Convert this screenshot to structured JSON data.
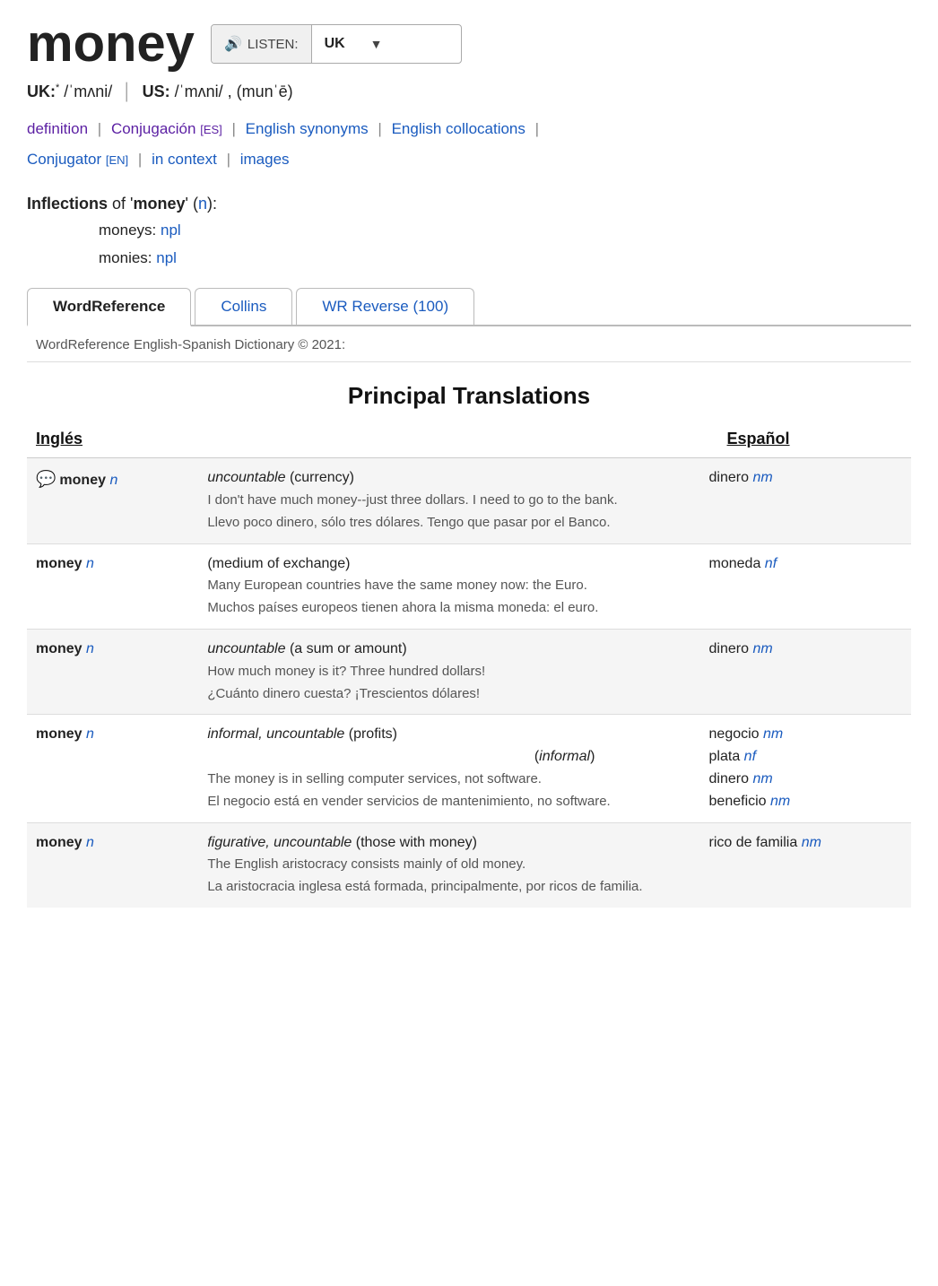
{
  "word": "money",
  "listen": {
    "button_label": "LISTEN:",
    "locale": "UK",
    "dropdown_arrow": "▼"
  },
  "phonetics": {
    "uk_label": "UK:",
    "uk_asterisk": "*",
    "uk_ipa": "/ˈmʌni/",
    "us_label": "US:",
    "us_ipa": "/ˈmʌni/",
    "us_alt": "(munˈē)"
  },
  "nav_links": [
    {
      "text": "definition",
      "color": "purple"
    },
    {
      "text": "Conjugación",
      "tag": "[ES]",
      "color": "purple"
    },
    {
      "text": "English synonyms",
      "color": "blue"
    },
    {
      "text": "English collocations",
      "color": "blue"
    },
    {
      "text": "Conjugator",
      "tag": "[EN]",
      "color": "blue"
    },
    {
      "text": "in context",
      "color": "blue"
    },
    {
      "text": "images",
      "color": "blue"
    }
  ],
  "inflections": {
    "title": "Inflections",
    "word": "money",
    "pos": "n",
    "items": [
      {
        "label": "moneys:",
        "value": "npl"
      },
      {
        "label": "monies:",
        "value": "npl"
      }
    ]
  },
  "tabs": [
    {
      "id": "wordreference",
      "label": "WordReference",
      "active": true
    },
    {
      "id": "collins",
      "label": "Collins",
      "active": false
    },
    {
      "id": "wr-reverse",
      "label": "WR Reverse (100)",
      "active": false
    }
  ],
  "dict_notice": "WordReference English-Spanish Dictionary © 2021:",
  "section_heading": "Principal Translations",
  "col_en": "Inglés",
  "col_es": "Español",
  "rows": [
    {
      "id": "row1",
      "has_chat": true,
      "en_word": "money",
      "en_pos": "n",
      "def_qualifier": "uncountable",
      "def_text": "(currency)",
      "es_word": "dinero",
      "es_pos": "nm",
      "example_en": "I don't have much money--just three dollars. I need to go to the bank.",
      "example_es": "Llevo poco dinero, sólo tres dólares. Tengo que pasar por el Banco.",
      "indent": false,
      "extra_es": []
    },
    {
      "id": "row2",
      "has_chat": false,
      "en_word": "money",
      "en_pos": "n",
      "def_qualifier": "",
      "def_text": "(medium of exchange)",
      "es_word": "moneda",
      "es_pos": "nf",
      "example_en": "Many European countries have the same money now: the Euro.",
      "example_es": "Muchos países europeos tienen ahora la misma moneda: el euro.",
      "indent": false,
      "extra_es": []
    },
    {
      "id": "row3",
      "has_chat": false,
      "en_word": "money",
      "en_pos": "n",
      "def_qualifier": "uncountable",
      "def_text": "(a sum or amount)",
      "es_word": "dinero",
      "es_pos": "nm",
      "example_en": "How much money is it? Three hundred dollars!",
      "example_es": "¿Cuánto dinero cuesta? ¡Trescientos dólares!",
      "indent": false,
      "extra_es": []
    },
    {
      "id": "row4",
      "has_chat": false,
      "en_word": "money",
      "en_pos": "n",
      "def_qualifier": "informal, uncountable",
      "def_text": "(profits)",
      "def_informal": "(informal)",
      "es_word": "negocio",
      "es_pos": "nm",
      "example_en": "The money is in selling computer services, not software.",
      "example_es": "El negocio está en vender servicios de mantenimiento, no software.",
      "indent": true,
      "extra_es": [
        {
          "word": "plata",
          "pos": "nf"
        },
        {
          "word": "dinero",
          "pos": "nm"
        },
        {
          "word": "beneficio",
          "pos": "nm"
        }
      ]
    },
    {
      "id": "row5",
      "has_chat": false,
      "en_word": "money",
      "en_pos": "n",
      "def_qualifier": "figurative, uncountable",
      "def_text": "(those with money)",
      "es_word": "rico de familia",
      "es_pos": "nm",
      "example_en": "The English aristocracy consists mainly of old money.",
      "example_es": "La aristocracia inglesa está formada, principalmente, por ricos de familia.",
      "indent": false,
      "extra_es": []
    }
  ]
}
